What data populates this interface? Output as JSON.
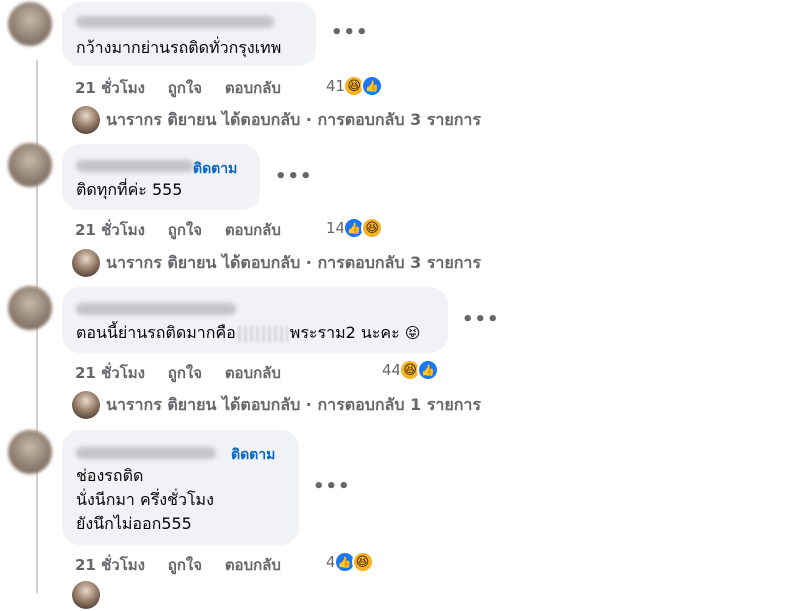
{
  "comments": [
    {
      "text_lines": [
        "กว้างมากย่านรถติดทั่วกรุงเทพ"
      ],
      "follow": "",
      "actions": [
        "21 ชั่วโมง",
        "ถูกใจ",
        "ตอบกลับ"
      ],
      "reaction_count": "41",
      "reply_summary": "นารากร ติยายน ได้ตอบกลับ · การตอบกลับ 3 รายการ"
    },
    {
      "text_lines": [
        "ติดทุกที่ค่ะ 555"
      ],
      "follow": "ติดตาม",
      "actions": [
        "21 ชั่วโมง",
        "ถูกใจ",
        "ตอบกลับ"
      ],
      "reaction_count": "14",
      "reply_summary": "นารากร ติยายน ได้ตอบกลับ · การตอบกลับ 3 รายการ"
    },
    {
      "text_lines": [
        "ตอนนี้ย่านรถติดมากคือ",
        "พระราม2 นะคะ"
      ],
      "follow": "",
      "actions": [
        "21 ชั่วโมง",
        "ถูกใจ",
        "ตอบกลับ"
      ],
      "reaction_count": "44",
      "reply_summary": "นารากร ติยายน ได้ตอบกลับ · การตอบกลับ 1 รายการ"
    },
    {
      "text_lines": [
        "ช่องรถติด",
        "นั่งนีกมา ครึ่งชั่วโมง",
        "ยังนึกไม่ออก555"
      ],
      "follow": "ติดตาม",
      "actions": [
        "21 ชั่วโมง",
        "ถูกใจ",
        "ตอบกลับ"
      ],
      "reaction_count": "4"
    }
  ],
  "icons": {
    "laugh": "laugh-reaction-icon",
    "like": "like-reaction-icon",
    "more": "more-options-icon",
    "squint_emoji": "😝"
  },
  "colors": {
    "link_blue": "#0a66c2",
    "bubble_bg": "#f0f2f5",
    "meta_gray": "#65676b",
    "like_blue": "#1877f2",
    "laugh_yellow": "#f7b125"
  }
}
